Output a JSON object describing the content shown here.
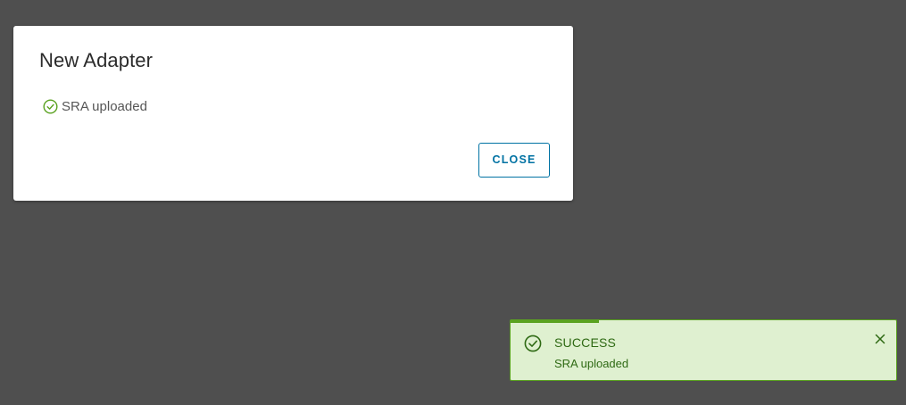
{
  "modal": {
    "title": "New Adapter",
    "status_icon": "check-circle-icon",
    "status_text": "SRA uploaded",
    "close_label": "CLOSE"
  },
  "toast": {
    "icon": "check-circle-icon",
    "title": "SUCCESS",
    "message": "SRA uploaded",
    "close_icon": "close-icon",
    "progress": 0.23
  },
  "colors": {
    "overlay": "#4f4f4f",
    "accent": "#0072a3",
    "success": "#5aa220",
    "success_bg": "#dff0d0",
    "success_text": "#2f6a14"
  }
}
